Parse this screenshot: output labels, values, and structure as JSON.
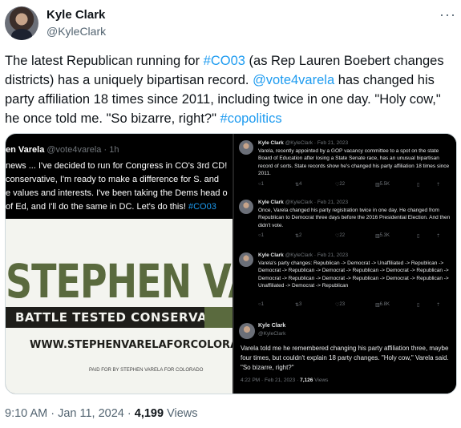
{
  "author": {
    "name": "Kyle Clark",
    "handle": "@KyleClark",
    "more_icon": "ellipsis-icon"
  },
  "tweet": {
    "segments": [
      {
        "text": "The latest Republican running for ",
        "link": false
      },
      {
        "text": "#CO03",
        "link": true
      },
      {
        "text": " (as Rep Lauren Boebert changes districts) has a uniquely bipartisan record. ",
        "link": false
      },
      {
        "text": "@vote4varela",
        "link": true
      },
      {
        "text": " has changed his party affiliation 18 times since 2011, including twice in one day. \"Holy cow,\" he once told me. \"So bizarre, right?\" ",
        "link": false
      },
      {
        "text": "#copolitics",
        "link": true
      }
    ]
  },
  "media_left": {
    "author_name": "en Varela",
    "author_handle": "@vote4varela",
    "author_time": "· 1h",
    "lines": [
      "news ... I've decided to run for Congress in CO's 3rd CD!",
      " conservative, I'm ready to make a difference for S. and",
      "e values and interests. I've been taking the Dems head o",
      "of Ed, and I'll do the same in DC. Let's do this! "
    ],
    "hashtag": "#CO03",
    "sign": {
      "name": "STEPHEN VARE",
      "tagline": "BATTLE TESTED CONSERVATIVE",
      "url": "WWW.STEPHENVARELAFORCOLORADO.COM",
      "paid": "PAID FOR BY STEPHEN VARELA FOR COLORADO",
      "colors": {
        "green": "#5a6a3e",
        "dark": "#1e1e1a",
        "background": "#f3f4ef"
      }
    }
  },
  "media_right": {
    "posts": [
      {
        "name": "Kyle Clark",
        "handle": "@KyleClark",
        "date": "· Feb 21, 2023",
        "body": "Varela, recently appointed by a GOP vacancy committee to a spot on the state Board of Education after losing a State Senate race, has an unusual bipartisan record of sorts. State records show he's changed his party affiliation 18 times since 2011.",
        "actions": {
          "replies": "1",
          "reposts": "4",
          "likes": "22",
          "views": "5.5K"
        }
      },
      {
        "name": "Kyle Clark",
        "handle": "@KyleClark",
        "date": "· Feb 21, 2023",
        "body": "Once, Varela changed his party registration twice in one day. He changed from Republican to Democrat three days before the 2016 Presidential Election. And then didn't vote.",
        "actions": {
          "replies": "1",
          "reposts": "2",
          "likes": "22",
          "views": "5.3K"
        }
      },
      {
        "name": "Kyle Clark",
        "handle": "@KyleClark",
        "date": "· Feb 21, 2023",
        "body": "Varela's party changes: Republican -> Democrat -> Unaffiliated -> Republican -> Democrat -> Republican -> Democrat -> Republican -> Democrat -> Republican -> Democrat -> Republican -> Democrat -> Republican -> Democrat -> Republican -> Unaffiliated -> Democrat -> Republican",
        "actions": {
          "replies": "1",
          "reposts": "3",
          "likes": "23",
          "views": "6.8K"
        }
      }
    ],
    "final": {
      "name": "Kyle Clark",
      "handle": "@KyleClark",
      "body": "Varela told me he remembered changing his party affiliation three, maybe four times, but couldn't explain 18 party changes. \"Holy cow,\" Varela said. \"So bizarre, right?\"",
      "time": "4:22 PM · Feb 21, 2023 · ",
      "views_count": "7,126",
      "views_label": " Views"
    }
  },
  "footer": {
    "timestamp": "9:10 AM · Jan 11, 2024 · ",
    "views_count": "4,199",
    "views_label": " Views"
  }
}
